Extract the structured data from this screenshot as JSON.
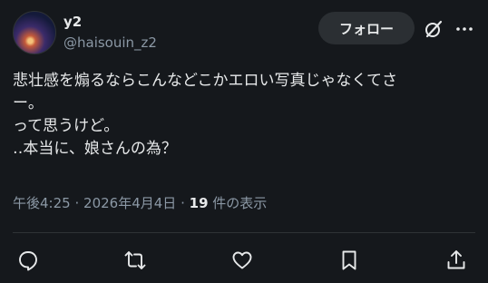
{
  "author": {
    "display_name": "y2",
    "handle": "@haisouin_z2",
    "avatar_icon": "avatar-image"
  },
  "header": {
    "follow_label": "フォロー",
    "grok_icon": "grok-icon",
    "more_icon": "more-icon"
  },
  "tweet": {
    "lines": [
      "悲壮感を煽るならこんなどこかエロい写真じゃなくてさ",
      "ー。",
      "って思うけど。",
      "‥本当に、娘さんの為？"
    ]
  },
  "meta": {
    "time": "午後4:25",
    "date": "2026年4月4日",
    "separator": "·",
    "view_count": "19",
    "view_label": "件の表示"
  },
  "actions": {
    "reply_icon": "reply-icon",
    "retweet_icon": "retweet-icon",
    "like_icon": "like-icon",
    "bookmark_icon": "bookmark-icon",
    "share_icon": "share-icon"
  },
  "colors": {
    "background": "#15181c",
    "text": "#e7e9ea",
    "secondary": "#8b98a5",
    "button": "#2b2f33"
  }
}
